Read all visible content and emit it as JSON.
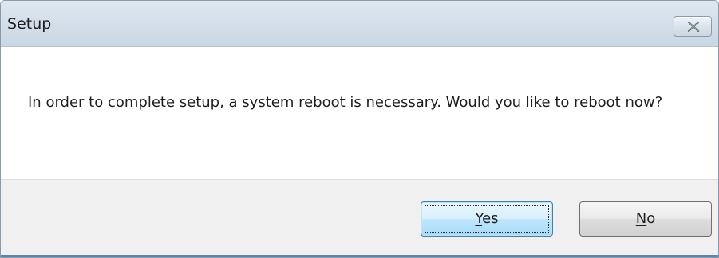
{
  "window": {
    "title": "Setup",
    "close_icon": "close-icon"
  },
  "message": {
    "text": "In order to complete setup, a system reboot is necessary. Would you like to reboot now?"
  },
  "buttons": {
    "yes": {
      "mnemonic": "Y",
      "rest": "es",
      "is_default": true
    },
    "no": {
      "mnemonic": "N",
      "rest": "o",
      "is_default": false
    }
  },
  "colors": {
    "titlebar": "#d4dfea",
    "footer": "#f0f0f0",
    "default_button_border": "#3c7fb1"
  }
}
